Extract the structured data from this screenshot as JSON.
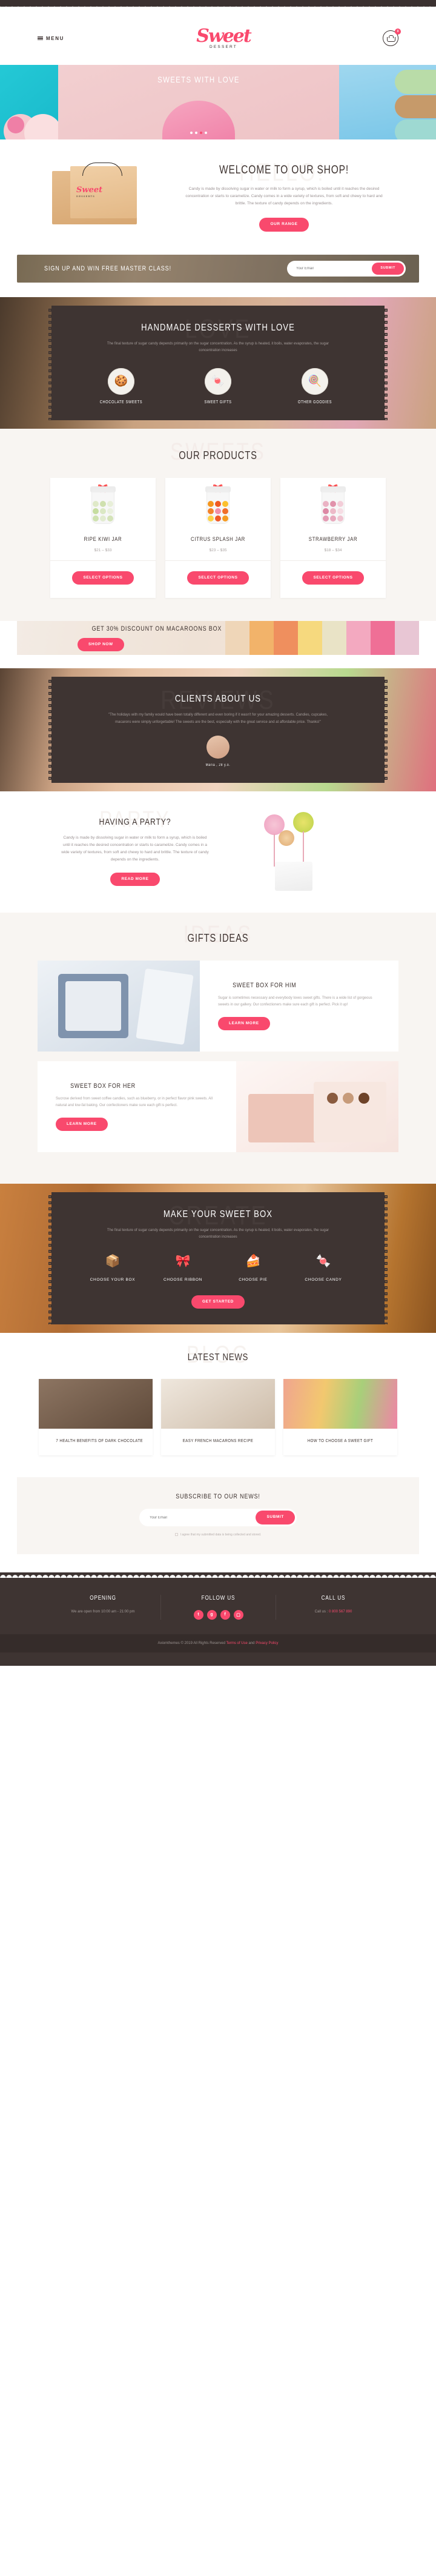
{
  "header": {
    "menu_label": "MENU",
    "logo_word": "Sweet",
    "logo_sub": "DESSERT",
    "cart_count": "0"
  },
  "hero": {
    "title": "Sweets With Love",
    "slide_dots": 4,
    "active_dot": 3
  },
  "welcome": {
    "watermark": "HELLO!",
    "title": "Welcome To Our Shop!",
    "body": "Candy is made by dissolving sugar in water or milk to form a syrup, which is boiled until it reaches the desired concentration or starts to caramelize. Candy comes in a wide variety of textures, from soft and chewy to hard and brittle. The texture of candy depends on the ingredients.",
    "button": "OUR RANGE",
    "bag_logo": "Sweet",
    "bag_logo_sub": "DESSERTS"
  },
  "newsletter_strip": {
    "title": "Sign Up and Win free Master Class!",
    "input_placeholder": "Your Email",
    "button": "SUBMIT"
  },
  "handmade": {
    "watermark": "LOVE",
    "title": "Handmade Desserts With Love",
    "body": "The final texture of sugar candy depends primarily on the sugar concentration. As the syrup is heated, it boils, water evaporates, the sugar concentration increases",
    "features": [
      {
        "icon": "cupcake-icon",
        "glyph": "\u0001",
        "label": "Chocolate Sweets"
      },
      {
        "icon": "candy-icon",
        "glyph": "\u0001",
        "label": "Sweet Gifts"
      },
      {
        "icon": "lollipop-icon",
        "glyph": "\u0001",
        "label": "Other Goodies"
      }
    ]
  },
  "products": {
    "watermark": "SWEETS",
    "title": "Our Products",
    "items": [
      {
        "name": "Ripe Kiwi Jar",
        "price": "$21 – $33",
        "button": "SELECT OPTIONS",
        "ribbon_color": "#58c24a",
        "candy_colors": [
          "#dfe9c8",
          "#cfe0ae",
          "#e8efd9",
          "#c6dda0",
          "#dbe8c4",
          "#eaf0de",
          "#cfe2b0",
          "#e2ebd0",
          "#d4e3b8"
        ]
      },
      {
        "name": "Citrus Splash Jar",
        "price": "$23 – $35",
        "button": "SELECT OPTIONS",
        "ribbon_color": "#e23b33",
        "candy_colors": [
          "#f5961e",
          "#f05a22",
          "#fbc02d",
          "#f4822a",
          "#f28ea8",
          "#f06e2a",
          "#fdd148",
          "#ef5a28",
          "#f59b22"
        ]
      },
      {
        "name": "Strawberry Jar",
        "price": "$18 – $34",
        "button": "SELECT OPTIONS",
        "ribbon_color": "#e23b68",
        "candy_colors": [
          "#eab3c4",
          "#e192ab",
          "#f3cdd8",
          "#dd89a5",
          "#edb9c8",
          "#f6dde4",
          "#e49cb4",
          "#e8a8bd",
          "#f0c3d0"
        ]
      }
    ]
  },
  "promo": {
    "title": "Get 30% Discount on Macaroons Box",
    "button": "SHOP NOW"
  },
  "testimonial": {
    "watermark": "REVIEWS",
    "title": "Clients About Us",
    "quote": "\"The holidays with my family would have been totally different and even boring if it wasn't for your amazing desserts. Candies, cupcakes, macarons were simply unforgettable! The sweets are the best, especially with the great service and at affordable price. Thanks!\"",
    "client": "Maria , 28 y.o."
  },
  "party": {
    "watermark": "PARTY",
    "title": "Having A Party?",
    "body": "Candy is made by dissolving sugar in water or milk to form a syrup, which is boiled until it reaches the desired concentration or starts to caramelize. Candy comes in a wide variety of textures, from soft and chewy to hard and brittle. The texture of candy depends on the ingredients.",
    "button": "READ MORE"
  },
  "gifts": {
    "watermark": "IDEAS",
    "title": "Gifts Ideas",
    "rows": [
      {
        "title": "Sweet Box For Him",
        "body": "Sugar is sometimes necessary and everybody loves sweet gifts. There is a wide list of gorgeous sweets in our gallery. Our confectioners make sure each gift is perfect. Pick it up!",
        "button": "LEARN MORE"
      },
      {
        "title": "Sweet Box For Her",
        "body": "Sucrose derived from sweet coffee candies, such as blueberry, or in perfect flavor pink sweets. All natural and low-fat baking. Our confectioners make sure each gift is perfect.",
        "button": "LEARN MORE"
      }
    ]
  },
  "makebox": {
    "watermark": "CREATE",
    "title": "Make Your Sweet Box",
    "body": "The final texture of sugar candy depends primarily on the sugar concentration. As the syrup is heated, it boils, water evaporates, the sugar concentration increases",
    "steps": [
      {
        "icon": "box-icon",
        "label": "Choose Your Box"
      },
      {
        "icon": "ribbon-icon",
        "label": "Choose Ribbon"
      },
      {
        "icon": "pie-icon",
        "label": "Choose Pie"
      },
      {
        "icon": "candy-icon",
        "label": "Choose Candy"
      }
    ],
    "button": "GET STARTED"
  },
  "news": {
    "watermark": "BLOG",
    "title": "Latest News",
    "items": [
      {
        "title": "7 Health Benefits of Dark Chocolate"
      },
      {
        "title": "Easy French Macarons Recipe"
      },
      {
        "title": "How to Choose a Sweet Gift"
      }
    ]
  },
  "subscribe": {
    "title": "Subscribe To Our News!",
    "input_placeholder": "Your Email",
    "button": "SUBMIT",
    "consent": "I agree that my submitted data is being collected and stored."
  },
  "footer": {
    "columns": [
      {
        "heading": "Opening",
        "text": "We are open from 10:00 am - 21:00 pm"
      },
      {
        "heading": "Follow Us",
        "text": ""
      },
      {
        "heading": "Call us",
        "text": "Call us : ",
        "phone": "0 800 567 890"
      }
    ],
    "socials": [
      {
        "name": "twitter-icon",
        "glyph": "t"
      },
      {
        "name": "google-plus-icon",
        "glyph": "g"
      },
      {
        "name": "facebook-icon",
        "glyph": "f"
      },
      {
        "name": "instagram-icon",
        "glyph": "▢"
      }
    ],
    "copyright_pre": "Axiomthemes © 2019 All Rights Reserved ",
    "terms": "Terms of Use",
    "and": " and ",
    "privacy": "Privacy Policy"
  },
  "colors": {
    "accent": "#f9496d",
    "dark": "#3e3432",
    "cream": "#f8f5f2"
  }
}
